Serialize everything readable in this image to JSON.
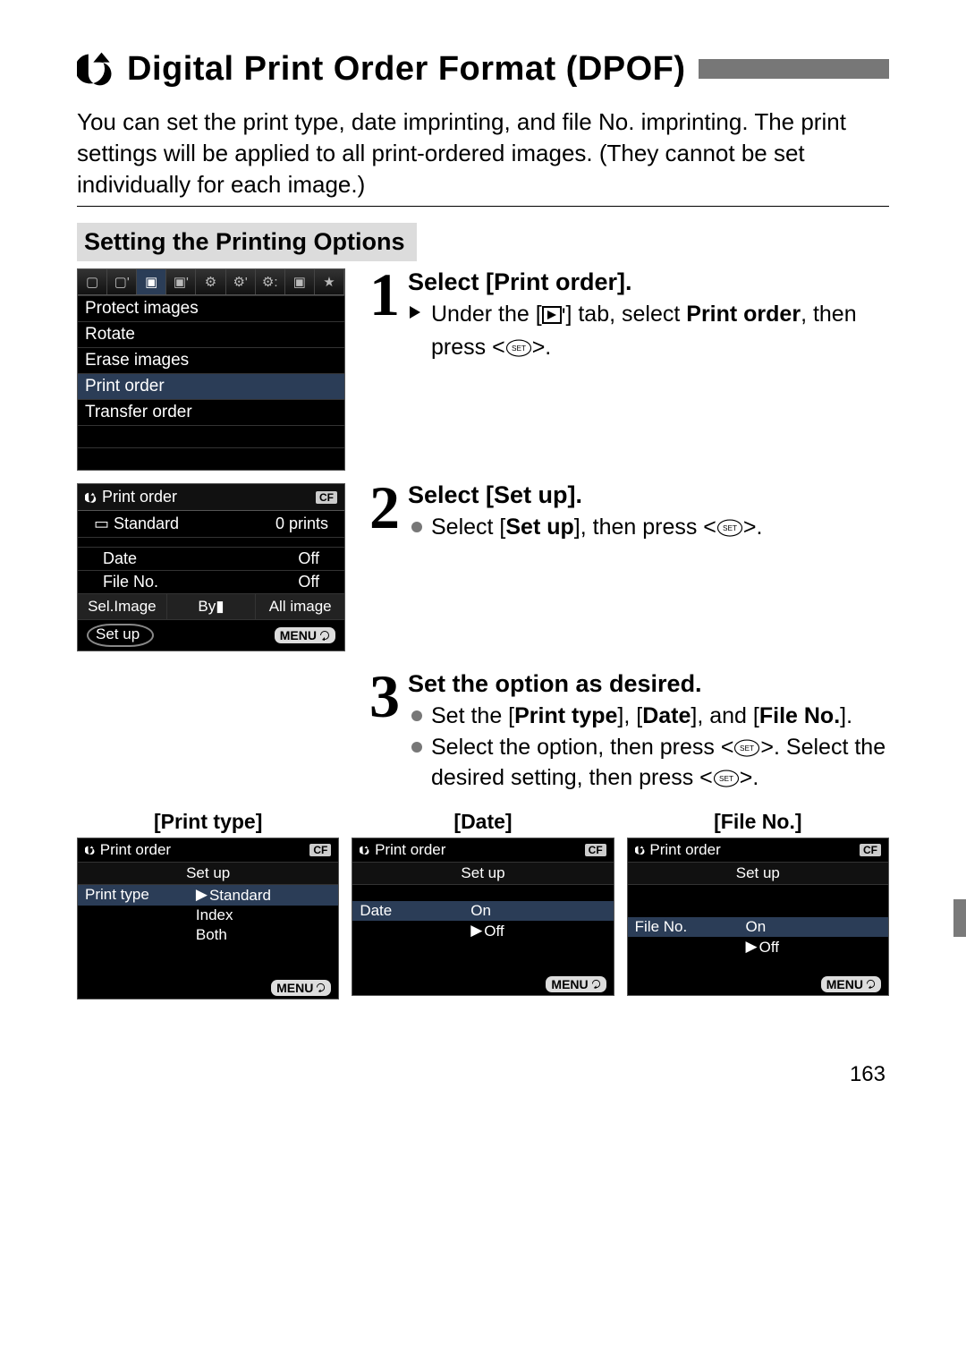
{
  "title": "Digital Print Order Format (DPOF)",
  "intro": "You can set the print type, date imprinting, and file No. imprinting. The print settings will be applied to all print-ordered images. (They cannot be set individually for each image.)",
  "sectionHead": "Setting the Printing Options",
  "menu1": {
    "items": [
      "Protect images",
      "Rotate",
      "Erase images",
      "Print order",
      "Transfer order"
    ],
    "selected": "Print order"
  },
  "menu2": {
    "title": "Print order",
    "cf": "CF",
    "typeLabel": "Standard",
    "printsLabel": "0 prints",
    "rows": [
      {
        "l": "Date",
        "r": "Off"
      },
      {
        "l": "File No.",
        "r": "Off"
      }
    ],
    "buttons": [
      "Sel.Image",
      "By",
      "All image"
    ],
    "setup": "Set up",
    "menu": "MENU"
  },
  "steps": [
    {
      "num": "1",
      "title": "Select [Print order].",
      "lines": [
        {
          "type": "arrow",
          "pre": "Under the [",
          "post": "] tab, select ",
          "bold": "Print order",
          "tail": ", then press <",
          "tail2": ">."
        }
      ]
    },
    {
      "num": "2",
      "title": "Select [Set up].",
      "lines": [
        {
          "type": "dot",
          "pre": "Select [",
          "bold": "Set up",
          "post": "], then press <",
          "tail2": ">."
        }
      ]
    },
    {
      "num": "3",
      "title": "Set the option as desired.",
      "lines": [
        {
          "type": "dot",
          "pre": "Set the [",
          "bold": "Print type",
          "post": "], [",
          "bold2": "Date",
          "post2": "], and [",
          "bold3": "File No.",
          "post3": "]."
        },
        {
          "type": "dot",
          "pre": "Select the option, then press <",
          "tail2": ">. Select the desired setting, then press <",
          "tail3": ">."
        }
      ]
    }
  ],
  "triple": [
    {
      "label": "[Print type]",
      "title": "Print order",
      "sub": "Set up",
      "rows": [
        {
          "l": "Print type",
          "v": "Standard",
          "sel": true,
          "caret": true
        },
        {
          "l": "",
          "v": "Index"
        },
        {
          "l": "",
          "v": "Both"
        }
      ]
    },
    {
      "label": "[Date]",
      "title": "Print order",
      "sub": "Set up",
      "rows": [
        {
          "l": "",
          "v": ""
        },
        {
          "l": "Date",
          "v": "On",
          "sel": true
        },
        {
          "l": "",
          "v": "Off",
          "caret": true
        }
      ]
    },
    {
      "label": "[File No.]",
      "title": "Print order",
      "sub": "Set up",
      "rows": [
        {
          "l": "",
          "v": ""
        },
        {
          "l": "",
          "v": ""
        },
        {
          "l": "File No.",
          "v": "On",
          "sel": true
        },
        {
          "l": "",
          "v": "Off",
          "caret": true
        }
      ]
    }
  ],
  "cf": "CF",
  "menuChip": "MENU",
  "pageNo": "163"
}
